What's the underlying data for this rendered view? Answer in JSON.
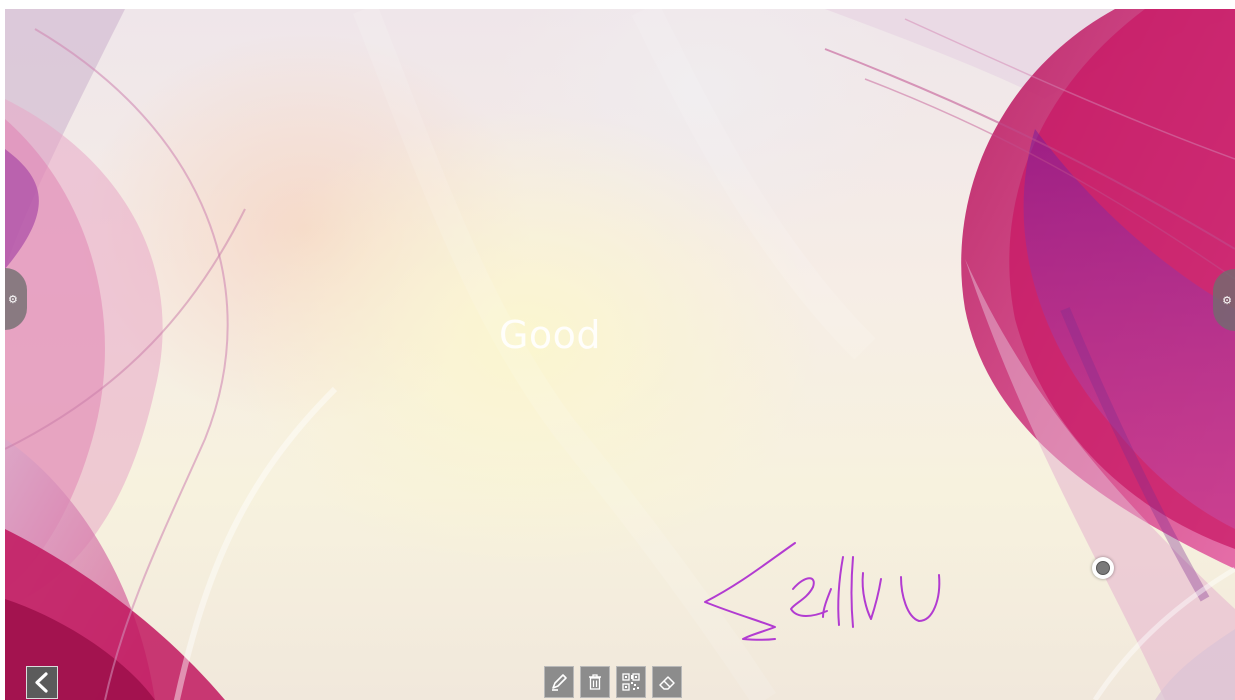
{
  "canvas": {
    "text": "Good",
    "handwriting_color": "#b23bd1"
  },
  "colors": {
    "accent_magenta": "#b0155f",
    "accent_pink": "#e0589d",
    "accent_purple": "#9a3aa8",
    "toolbar_button": "#8c8c8c"
  },
  "side_tabs": {
    "left_icon": "gear-icon",
    "right_icon": "gear-icon"
  },
  "toolbar": {
    "items": [
      {
        "icon": "pen-icon"
      },
      {
        "icon": "trash-icon"
      },
      {
        "icon": "qr-code-icon"
      },
      {
        "icon": "eraser-icon"
      }
    ]
  },
  "navigation": {
    "back_icon": "chevron-left-icon"
  }
}
